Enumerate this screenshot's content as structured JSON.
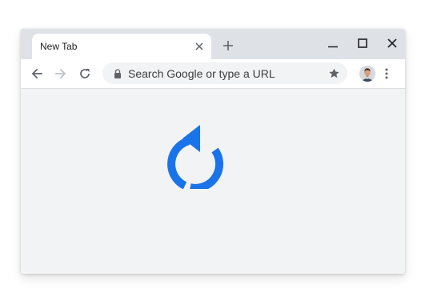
{
  "tab": {
    "title": "New Tab"
  },
  "omnibox": {
    "placeholder": "Search Google or type a URL"
  },
  "icons": {
    "tab_close": "close-icon",
    "new_tab": "plus-icon",
    "minimize": "minimize-icon",
    "maximize": "maximize-icon",
    "close_window": "close-icon",
    "back": "arrow-left-icon",
    "forward": "arrow-right-icon",
    "reload": "reload-icon",
    "lock": "lock-icon",
    "bookmark": "star-icon",
    "menu": "kebab-menu-icon",
    "illustration": "reload-icon"
  },
  "colors": {
    "accent": "#1a73e8",
    "tabstrip": "#dee1e6",
    "content_bg": "#f1f3f4",
    "icon": "#5f6368"
  }
}
